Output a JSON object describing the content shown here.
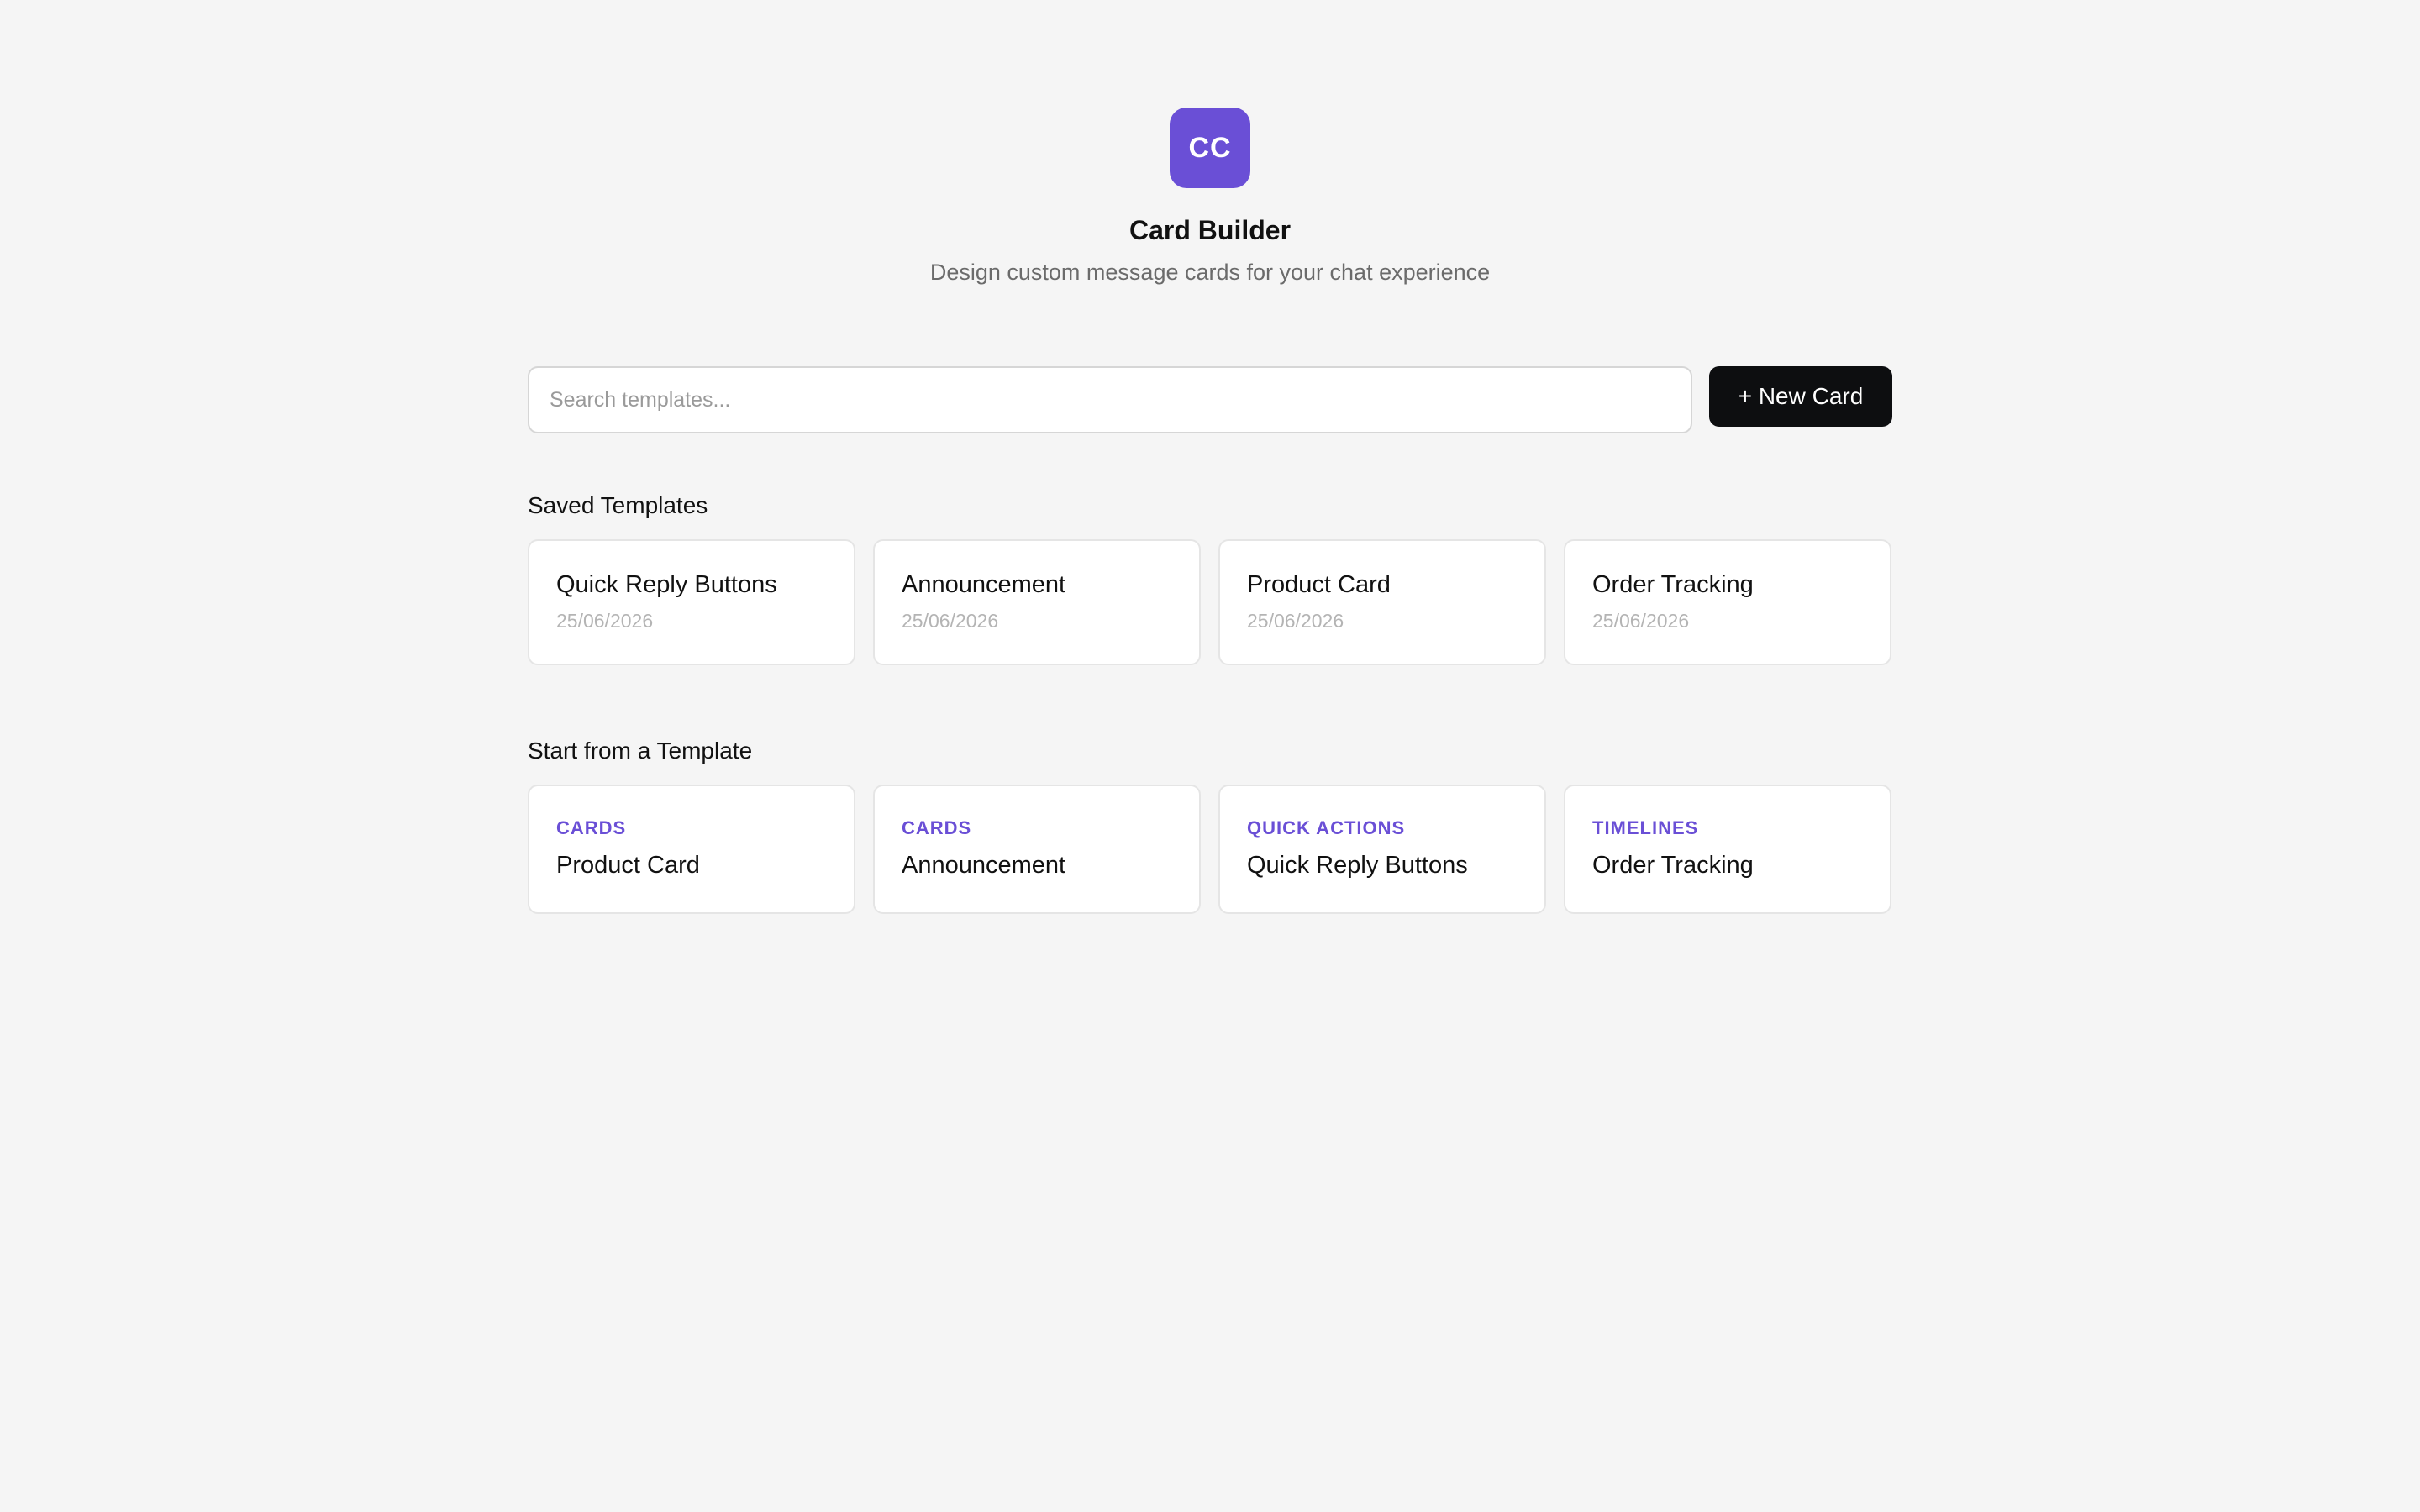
{
  "colors": {
    "accent": "#6a4fd6",
    "button_bg": "#0d0e10",
    "page_bg": "#f5f5f5"
  },
  "header": {
    "logo_text": "CC",
    "title": "Card Builder",
    "subtitle": "Design custom message cards for your chat experience"
  },
  "search": {
    "placeholder": "Search templates...",
    "value": ""
  },
  "toolbar": {
    "new_card_label": "+ New Card"
  },
  "saved": {
    "title": "Saved Templates",
    "items": [
      {
        "name": "Quick Reply Buttons",
        "date": "25/06/2026"
      },
      {
        "name": "Announcement",
        "date": "25/06/2026"
      },
      {
        "name": "Product Card",
        "date": "25/06/2026"
      },
      {
        "name": "Order Tracking",
        "date": "25/06/2026"
      }
    ]
  },
  "templates": {
    "title": "Start from a Template",
    "items": [
      {
        "category": "CARDS",
        "name": "Product Card"
      },
      {
        "category": "CARDS",
        "name": "Announcement"
      },
      {
        "category": "QUICK ACTIONS",
        "name": "Quick Reply Buttons"
      },
      {
        "category": "TIMELINES",
        "name": "Order Tracking"
      }
    ]
  }
}
